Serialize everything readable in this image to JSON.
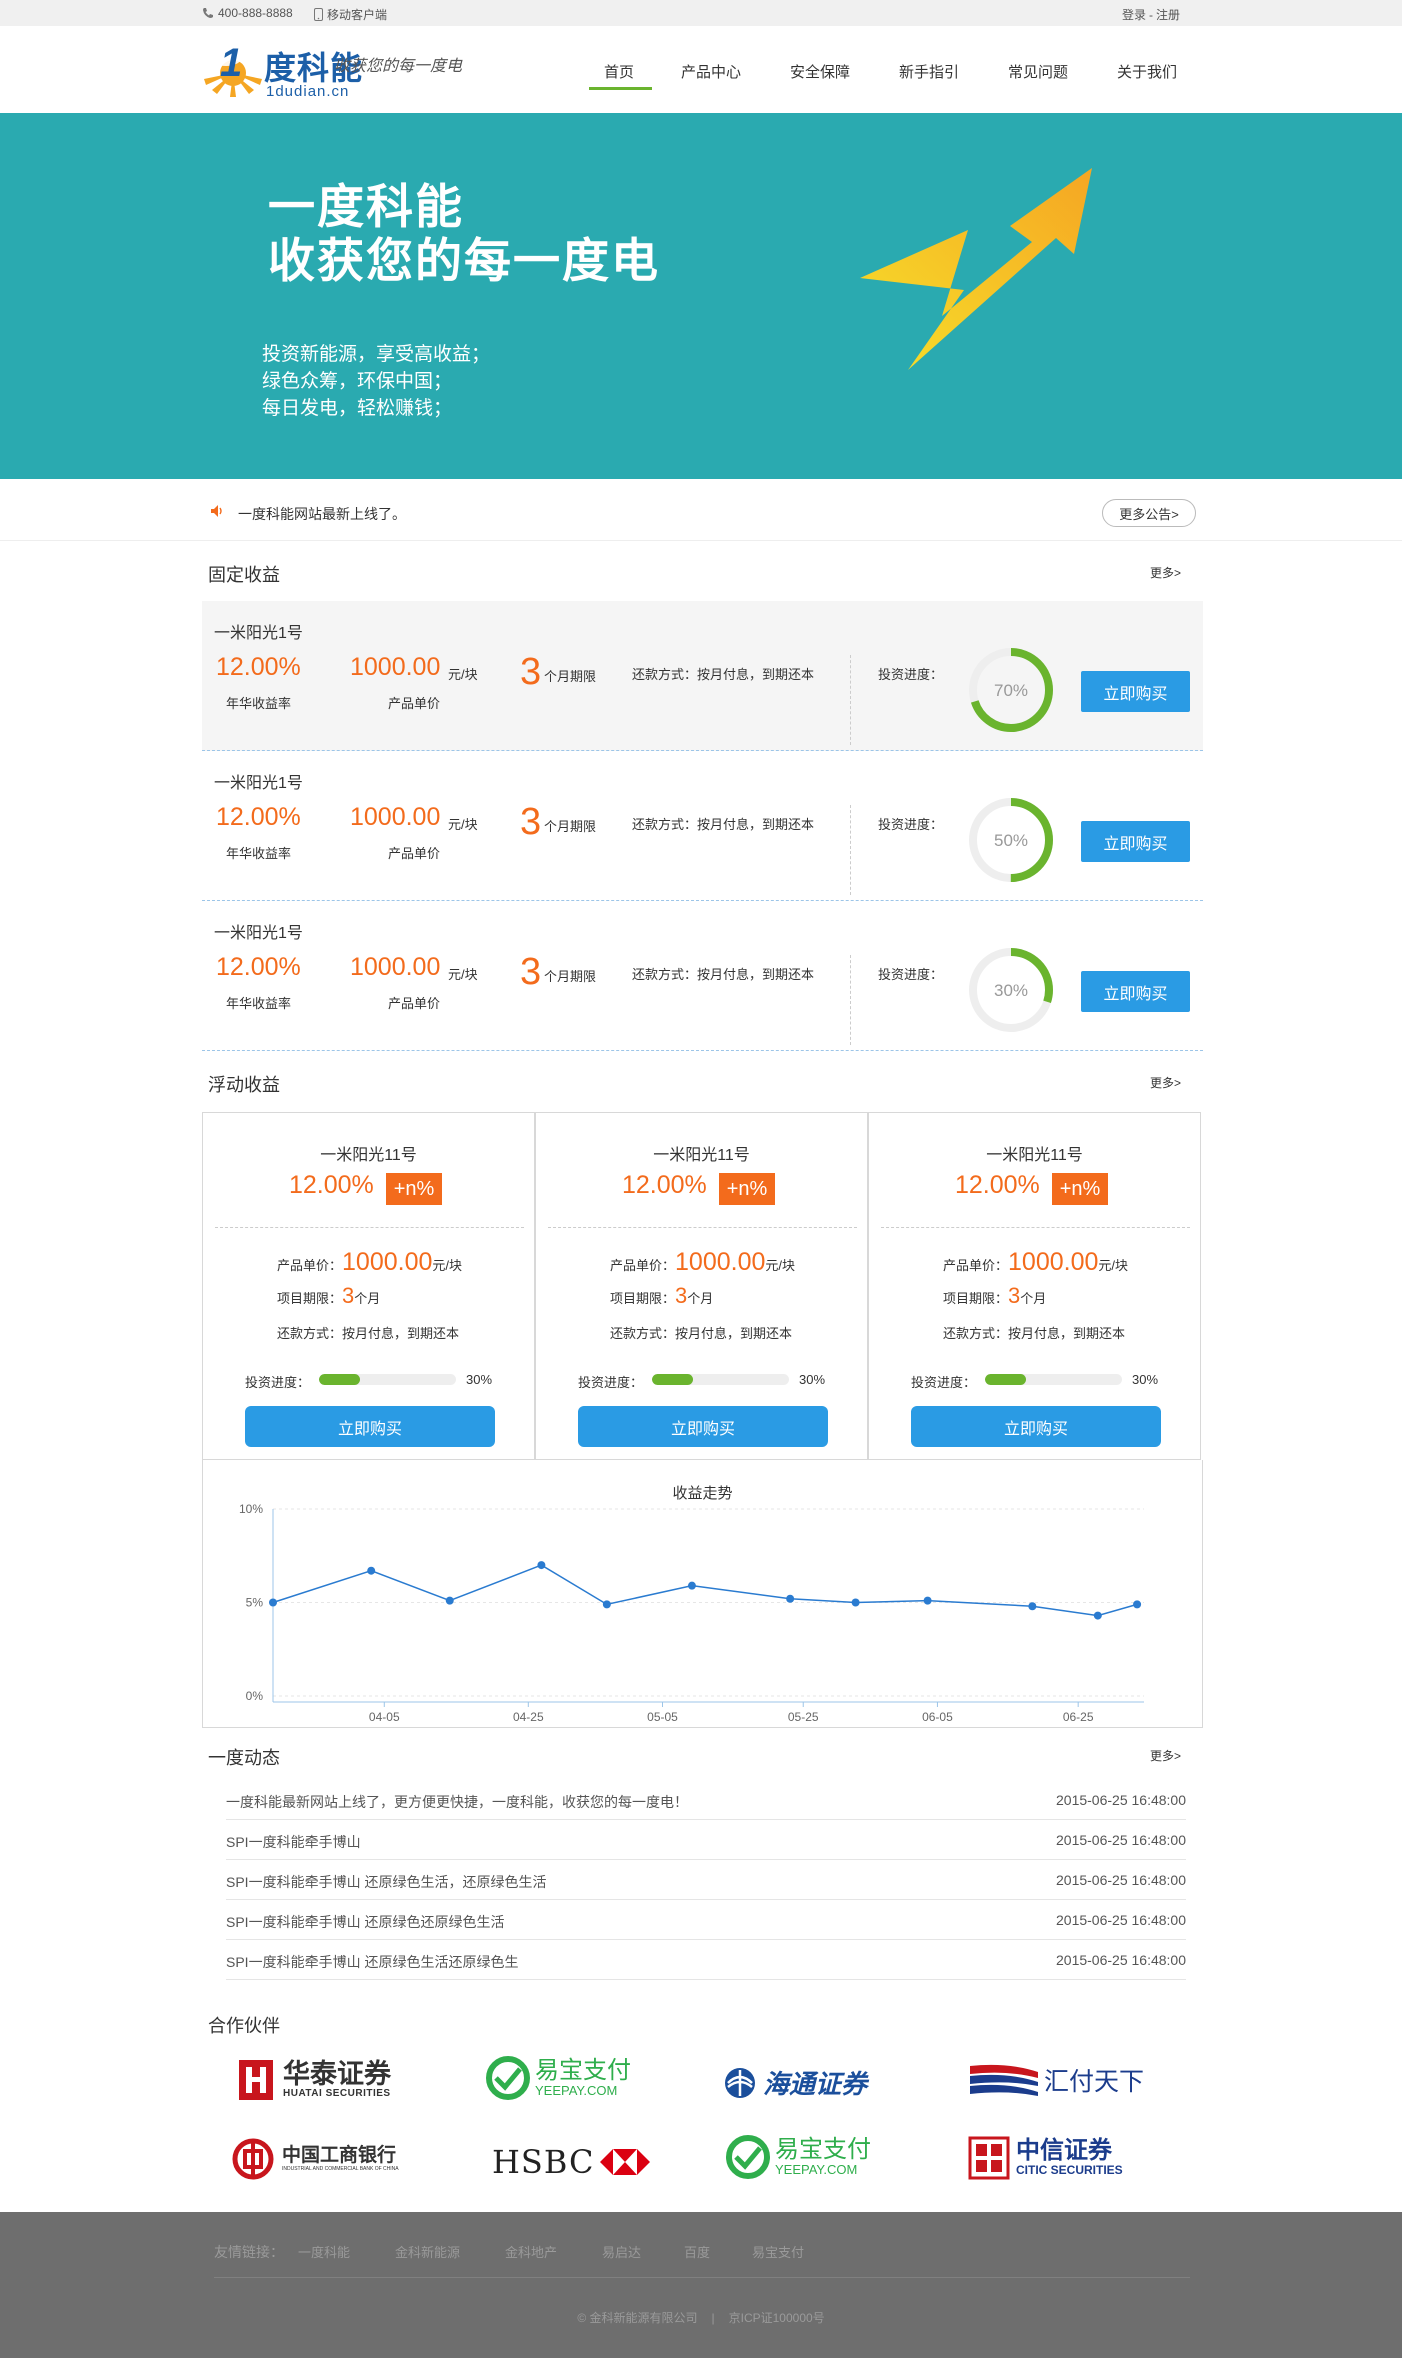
{
  "topbar": {
    "phone": "400-888-8888",
    "mobile_client": "移动客户端",
    "login": "登录",
    "separator": "-",
    "register": "注册"
  },
  "brand": {
    "name": "度科能",
    "number_mark": "1",
    "domain": "1dudian.cn",
    "slogan": "收获您的每一度电"
  },
  "nav": {
    "items": [
      "首页",
      "产品中心",
      "安全保障",
      "新手指引",
      "常见问题",
      "关于我们"
    ],
    "active_index": 0,
    "active_color": "#6ab42e"
  },
  "banner": {
    "title_line1": "一度科能",
    "title_line2": "收获您的每一度电",
    "lines": [
      "投资新能源，享受高收益；",
      "绿色众筹，环保中国；",
      "每日发电，轻松赚钱；"
    ],
    "bg_color": "#2aaab0",
    "slide_count": 3,
    "active_slide": 0
  },
  "notice": {
    "text": "一度科能网站最新上线了。",
    "more_label": "更多公告>"
  },
  "fixed": {
    "title": "固定收益",
    "more": "更多>",
    "products": [
      {
        "name": "一米阳光1号",
        "rate": "12.00%",
        "rate_label": "年华收益率",
        "price": "1000.00",
        "price_unit": "元/块",
        "price_label": "产品单价",
        "term": "3",
        "term_unit": "个月期限",
        "repay": "还款方式：按月付息，到期还本",
        "progress_label": "投资进度：",
        "progress": 70,
        "progress_text": "70%",
        "buy": "立即购买"
      },
      {
        "name": "一米阳光1号",
        "rate": "12.00%",
        "rate_label": "年华收益率",
        "price": "1000.00",
        "price_unit": "元/块",
        "price_label": "产品单价",
        "term": "3",
        "term_unit": "个月期限",
        "repay": "还款方式：按月付息，到期还本",
        "progress_label": "投资进度：",
        "progress": 50,
        "progress_text": "50%",
        "buy": "立即购买"
      },
      {
        "name": "一米阳光1号",
        "rate": "12.00%",
        "rate_label": "年华收益率",
        "price": "1000.00",
        "price_unit": "元/块",
        "price_label": "产品单价",
        "term": "3",
        "term_unit": "个月期限",
        "repay": "还款方式：按月付息，到期还本",
        "progress_label": "投资进度：",
        "progress": 30,
        "progress_text": "30%",
        "buy": "立即购买"
      }
    ]
  },
  "floating": {
    "title": "浮动收益",
    "more": "更多>",
    "products": [
      {
        "name": "一米阳光11号",
        "rate": "12.00%",
        "badge": "+n%",
        "price_label": "产品单价：",
        "price": "1000.00",
        "price_unit": "元/块",
        "term_label": "项目期限：",
        "term": "3",
        "term_unit": "个月",
        "repay": "还款方式：按月付息，到期还本",
        "progress_label": "投资进度：",
        "progress": 30,
        "progress_text": "30%",
        "buy": "立即购买"
      },
      {
        "name": "一米阳光11号",
        "rate": "12.00%",
        "badge": "+n%",
        "price_label": "产品单价：",
        "price": "1000.00",
        "price_unit": "元/块",
        "term_label": "项目期限：",
        "term": "3",
        "term_unit": "个月",
        "repay": "还款方式：按月付息，到期还本",
        "progress_label": "投资进度：",
        "progress": 30,
        "progress_text": "30%",
        "buy": "立即购买"
      },
      {
        "name": "一米阳光11号",
        "rate": "12.00%",
        "badge": "+n%",
        "price_label": "产品单价：",
        "price": "1000.00",
        "price_unit": "元/块",
        "term_label": "项目期限：",
        "term": "3",
        "term_unit": "个月",
        "repay": "还款方式：按月付息，到期还本",
        "progress_label": "投资进度：",
        "progress": 30,
        "progress_text": "30%",
        "buy": "立即购买"
      }
    ]
  },
  "chart_data": {
    "type": "line",
    "title": "收益走势",
    "xlabel": "",
    "ylabel": "",
    "ylim": [
      0,
      10
    ],
    "yticks": [
      0,
      5,
      10
    ],
    "ytick_labels": [
      "0%",
      "5%",
      "10%"
    ],
    "xtick_labels": [
      "04-05",
      "04-25",
      "05-05",
      "05-25",
      "06-05",
      "06-25"
    ],
    "xlim": [
      0,
      13
    ],
    "xtick_positions": [
      1.7,
      3.9,
      5.95,
      8.1,
      10.15,
      12.3
    ],
    "series": [
      {
        "x": [
          0,
          1.5,
          2.7,
          4.1,
          5.1,
          6.4,
          7.9,
          8.9,
          10.0,
          11.6,
          12.6,
          13.2
        ],
        "values": [
          5.0,
          6.7,
          5.1,
          7.0,
          4.9,
          5.9,
          5.2,
          5.0,
          5.1,
          4.8,
          4.3,
          4.9
        ]
      }
    ],
    "line_color": "#2a7bd0",
    "grid": true
  },
  "news": {
    "title": "一度动态",
    "more": "更多>",
    "items": [
      {
        "title": "一度科能最新网站上线了，更方便更快捷，一度科能，收获您的每一度电！",
        "date": "2015-06-25  16:48:00"
      },
      {
        "title": "SPI一度科能牵手博山",
        "date": "2015-06-25  16:48:00"
      },
      {
        "title": "SPI一度科能牵手博山 还原绿色生活，还原绿色生活",
        "date": "2015-06-25  16:48:00"
      },
      {
        "title": "SPI一度科能牵手博山 还原绿色还原绿色生活",
        "date": "2015-06-25  16:48:00"
      },
      {
        "title": "SPI一度科能牵手博山 还原绿色生活还原绿色生",
        "date": "2015-06-25  16:48:00"
      }
    ]
  },
  "partners": {
    "title": "合作伙伴",
    "huatai": {
      "cn": "华泰证券",
      "en": "HUATAI SECURITIES"
    },
    "yeepay": {
      "cn": "易宝支付",
      "en": "YEEPAY.COM"
    },
    "haitong": {
      "cn": "海通证券"
    },
    "huifu": {
      "cn": "汇付天下"
    },
    "icbc": {
      "cn": "中国工商银行",
      "en": "INDUSTRIAL AND COMMERCIAL BANK OF CHINA"
    },
    "hsbc": {
      "en": "HSBC"
    },
    "citic": {
      "cn": "中信证券",
      "en": "CITIC SECURITIES"
    }
  },
  "footer": {
    "links_label": "友情链接：",
    "links": [
      "一度科能",
      "金科新能源",
      "金科地产",
      "易启达",
      "百度",
      "易宝支付"
    ],
    "copyright": "©  金科新能源有限公司",
    "divider": "|",
    "icp": "京ICP证100000号"
  },
  "colors": {
    "orange": "#f36b1c",
    "blue": "#2a9be4",
    "green": "#6ab42e",
    "teal": "#2aaab0"
  }
}
